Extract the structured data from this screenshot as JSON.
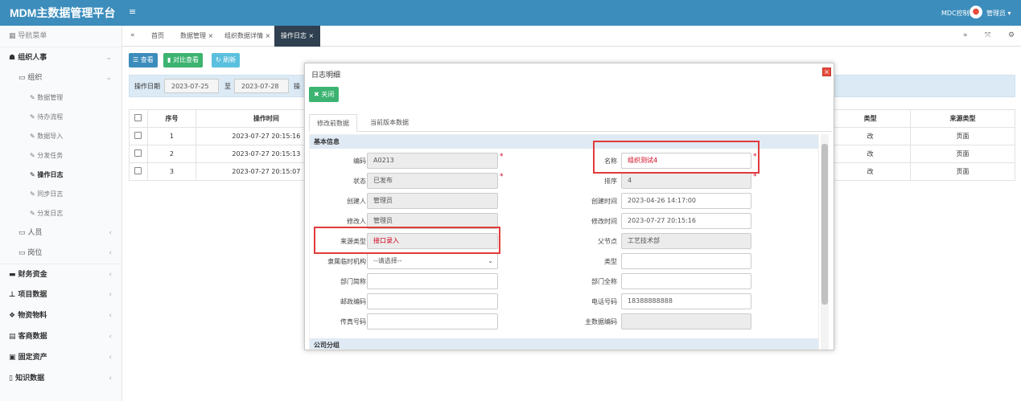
{
  "app": {
    "brand": "MDM主数据管理平台",
    "mdc": "MDC控制台",
    "user": "管理员 ▾"
  },
  "sidebar": {
    "nav_header": "导航菜单",
    "group_org": "组织人事",
    "sub_org": "组织",
    "leaves": [
      "数据管理",
      "待办流程",
      "数据导入",
      "分发任务",
      "操作日志",
      "同步日志",
      "分发日志"
    ],
    "sub_person": "人员",
    "sub_post": "岗位",
    "groups": [
      "财务资金",
      "项目数据",
      "物资物料",
      "客商数据",
      "固定资产",
      "知识数据"
    ]
  },
  "tabs": [
    "首页",
    "数据管理 ×",
    "组织数据详情 ×",
    "操作日志 ×"
  ],
  "toolbar": {
    "view": "查看",
    "compare": "对比查看",
    "refresh": "刷新"
  },
  "filter": {
    "label": "操作日期",
    "start": "2023-07-25",
    "to": "至",
    "end": "2023-07-28",
    "more": "操"
  },
  "table": {
    "headers": [
      "序号",
      "操作时间",
      "类型",
      "来源类型"
    ],
    "rows": [
      {
        "no": "1",
        "time": "2023-07-27 20:15:16",
        "type": "改",
        "src": "页面"
      },
      {
        "no": "2",
        "time": "2023-07-27 20:15:13",
        "type": "改",
        "src": "页面"
      },
      {
        "no": "3",
        "time": "2023-07-27 20:15:07",
        "type": "改",
        "src": "页面"
      }
    ]
  },
  "modal": {
    "title": "日志明细",
    "close": "关闭",
    "tab_before": "修改前数据",
    "tab_current": "当前版本数据",
    "section_basic": "基本信息",
    "section_company": "公司分组",
    "fields": {
      "code_label": "编码",
      "code": "A0213",
      "name_label": "名称",
      "name": "组织测试4",
      "status_label": "状态",
      "status": "已发布",
      "order_label": "排序",
      "order": "4",
      "creator_label": "创建人",
      "creator": "管理员",
      "ctime_label": "创建时间",
      "ctime": "2023-04-26 14:17:00",
      "modifier_label": "修改人",
      "modifier": "管理员",
      "mtime_label": "修改时间",
      "mtime": "2023-07-27 20:15:16",
      "source_label": "来源类型",
      "source": "接口录入",
      "parent_label": "父节点",
      "parent": "工艺技术部",
      "belong_label": "隶属临时机构",
      "belong": "--请选择--",
      "kind_label": "类型",
      "kind": "",
      "short_label": "部门简称",
      "short": "",
      "full_label": "部门全称",
      "full": "",
      "zip_label": "邮政编码",
      "zip": "",
      "phone_label": "电话号码",
      "phone": "18388888888",
      "fax_label": "传真号码",
      "fax": "",
      "mdm_label": "主数据编码",
      "mdm": ""
    }
  }
}
